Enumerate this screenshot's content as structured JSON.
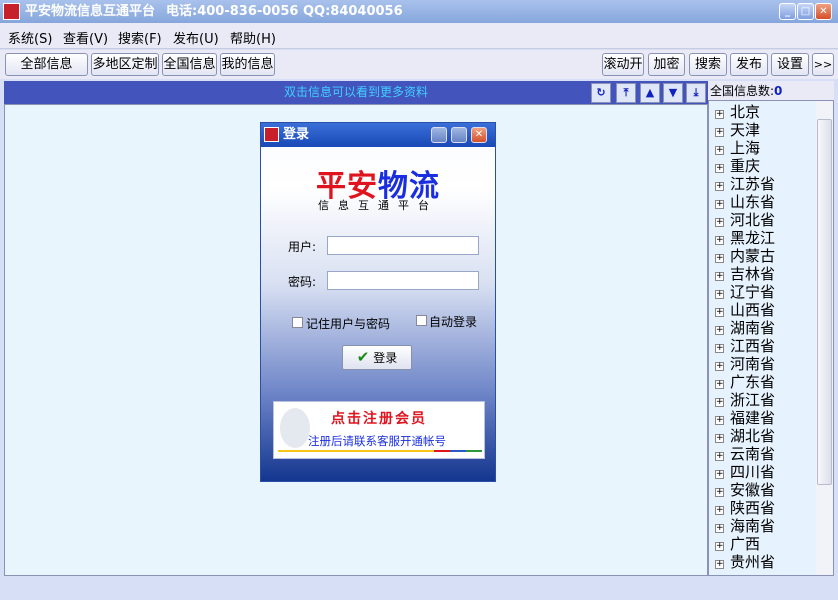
{
  "window": {
    "title": "平安物流信息互通平台",
    "contact": "电话:400-836-0056 QQ:84040056",
    "icon_text": "平安物流"
  },
  "menu": [
    "系统(S)",
    "查看(V)",
    "搜索(F)",
    "发布(U)",
    "帮助(H)"
  ],
  "toolbar_left": [
    "全部信息",
    "多地区定制",
    "全国信息",
    "我的信息"
  ],
  "toolbar_right": [
    "滚动开",
    "加密",
    "搜索",
    "发布",
    "设置",
    ">>"
  ],
  "strip": {
    "hint": "双击信息可以看到更多资料"
  },
  "right_panel": {
    "label": "全国信息数:",
    "count": "0",
    "regions": [
      "北京",
      "天津",
      "上海",
      "重庆",
      "江苏省",
      "山东省",
      "河北省",
      "黑龙江",
      "内蒙古",
      "吉林省",
      "辽宁省",
      "山西省",
      "湖南省",
      "江西省",
      "河南省",
      "广东省",
      "浙江省",
      "福建省",
      "湖北省",
      "云南省",
      "四川省",
      "安徽省",
      "陕西省",
      "海南省",
      "广西",
      "贵州省"
    ]
  },
  "login": {
    "title": "登录",
    "logo_red": "平安",
    "logo_blue": "物流",
    "logo_sub": "信息互通平台",
    "user_label": "用户:",
    "user_value": "",
    "pass_label": "密码:",
    "remember": "记住用户与密码",
    "auto": "自动登录",
    "submit": "登录",
    "register_title": "点击注册会员",
    "register_note": "注册后请联系客服开通帐号"
  },
  "colors": {
    "strip": "#4454bd",
    "logo_red": "#e0141e",
    "logo_blue": "#1a2ee0"
  }
}
